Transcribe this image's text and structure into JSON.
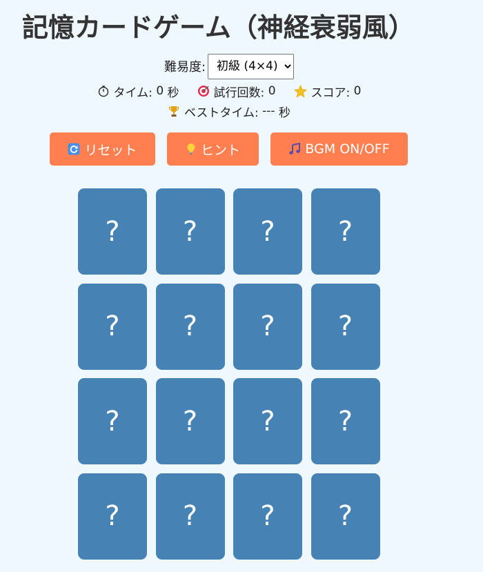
{
  "title": "記憶カードゲーム（神経衰弱風）",
  "difficulty": {
    "label": "難易度:",
    "selected": "初級 (4×4)"
  },
  "stats": {
    "time_label": "タイム:",
    "time_value": "0",
    "time_unit": "秒",
    "attempts_label": "試行回数:",
    "attempts_value": "0",
    "score_label": "スコア:",
    "score_value": "0"
  },
  "best": {
    "label": "ベストタイム:",
    "value": "---",
    "unit": "秒"
  },
  "buttons": {
    "reset": "リセット",
    "hint": "ヒント",
    "bgm": "BGM ON/OFF"
  },
  "icons": {
    "timer": "stopwatch-icon",
    "attempts": "target-icon",
    "score": "star-icon",
    "best": "trophy-icon",
    "reset": "refresh-icon",
    "hint": "lightbulb-icon",
    "bgm": "music-note-icon"
  },
  "colors": {
    "background": "#f0f8ff",
    "button": "#ff7f50",
    "card_back": "#4682b4",
    "card_text": "#ffffff"
  },
  "board": {
    "grid": "4×4",
    "cards": [
      "?",
      "?",
      "?",
      "?",
      "?",
      "?",
      "?",
      "?",
      "?",
      "?",
      "?",
      "?",
      "?",
      "?",
      "?",
      "?"
    ]
  }
}
